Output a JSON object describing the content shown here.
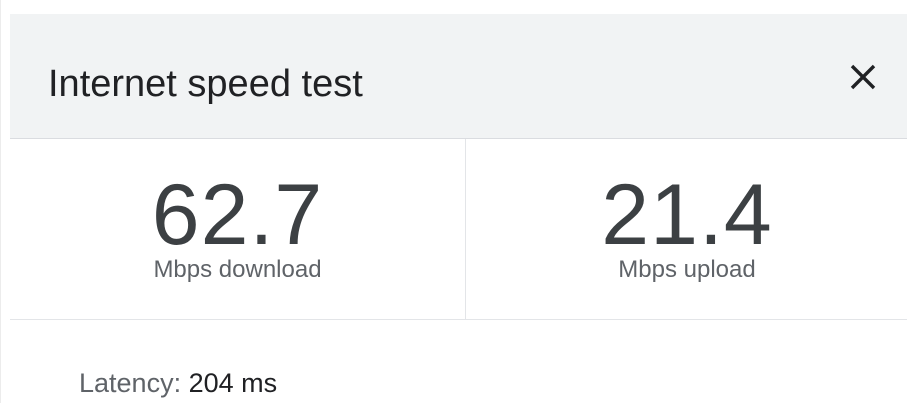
{
  "header": {
    "title": "Internet speed test",
    "close_icon": "close-icon"
  },
  "results": {
    "download": {
      "value": "62.7",
      "unit": "Mbps download"
    },
    "upload": {
      "value": "21.4",
      "unit": "Mbps upload"
    }
  },
  "latency": {
    "label": "Latency: ",
    "value": "204 ms"
  },
  "colors": {
    "header_bg": "#f1f3f4",
    "title_text": "#202124",
    "value_text": "#3c4043",
    "secondary_text": "#5f6368",
    "divider": "#e3e5e8"
  }
}
